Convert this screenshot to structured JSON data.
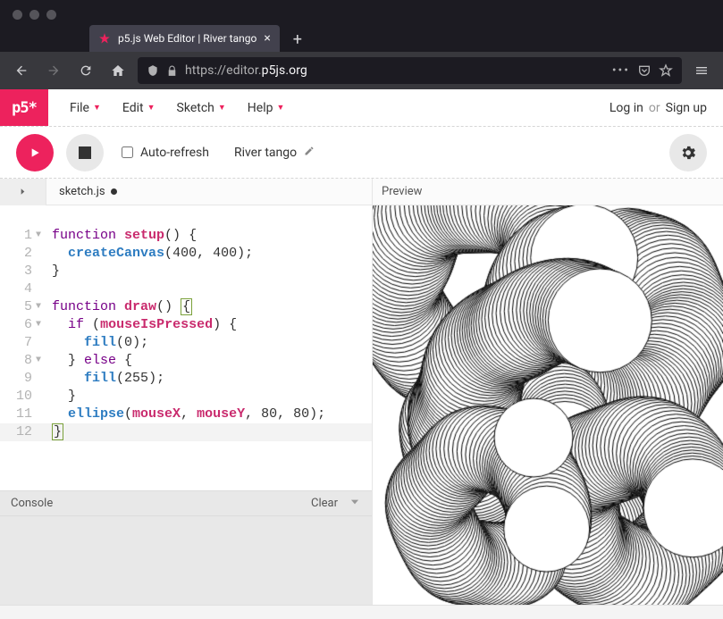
{
  "browser": {
    "tab_title": "p5.js Web Editor | River tango",
    "url_proto_sub": "https://editor.",
    "url_host_rest": "p5js.org",
    "new_tab": "+"
  },
  "app": {
    "logo": "p5*",
    "menu": [
      "File",
      "Edit",
      "Sketch",
      "Help"
    ],
    "auth": {
      "login": "Log in",
      "or": "or",
      "signup": "Sign up"
    }
  },
  "toolbar": {
    "auto_refresh_label": "Auto-refresh",
    "sketch_name": "River tango"
  },
  "editor": {
    "filename": "sketch.js",
    "lines": [
      {
        "n": 1,
        "fold": true,
        "tokens": [
          [
            "kw",
            "function"
          ],
          [
            "",
            ""
          ],
          [
            "var",
            "setup"
          ],
          [
            "punct",
            "() "
          ],
          [
            "brace",
            "{"
          ]
        ]
      },
      {
        "n": 2,
        "fold": false,
        "tokens": [
          [
            "",
            "  "
          ],
          [
            "p5fn",
            "createCanvas"
          ],
          [
            "punct",
            "("
          ],
          [
            "num",
            "400"
          ],
          [
            "punct",
            ", "
          ],
          [
            "num",
            "400"
          ],
          [
            "punct",
            ");"
          ]
        ]
      },
      {
        "n": 3,
        "fold": false,
        "tokens": [
          [
            "punct",
            "}"
          ]
        ]
      },
      {
        "n": 4,
        "fold": false,
        "tokens": []
      },
      {
        "n": 5,
        "fold": true,
        "tokens": [
          [
            "kw",
            "function"
          ],
          [
            "",
            ""
          ],
          [
            "var",
            "draw"
          ],
          [
            "punct",
            "() "
          ],
          [
            "bracebox",
            "{"
          ]
        ]
      },
      {
        "n": 6,
        "fold": true,
        "tokens": [
          [
            "",
            "  "
          ],
          [
            "kw",
            "if"
          ],
          [
            "",
            ""
          ],
          [
            "punct",
            "("
          ],
          [
            "var",
            "mouseIsPressed"
          ],
          [
            "punct",
            ") {"
          ]
        ]
      },
      {
        "n": 7,
        "fold": false,
        "tokens": [
          [
            "",
            "    "
          ],
          [
            "p5fn",
            "fill"
          ],
          [
            "punct",
            "("
          ],
          [
            "num",
            "0"
          ],
          [
            "punct",
            ");"
          ]
        ]
      },
      {
        "n": 8,
        "fold": true,
        "tokens": [
          [
            "",
            "  "
          ],
          [
            "punct",
            "} "
          ],
          [
            "kw",
            "else"
          ],
          [
            "punct",
            " {"
          ]
        ]
      },
      {
        "n": 9,
        "fold": false,
        "tokens": [
          [
            "",
            "    "
          ],
          [
            "p5fn",
            "fill"
          ],
          [
            "punct",
            "("
          ],
          [
            "num",
            "255"
          ],
          [
            "punct",
            ");"
          ]
        ]
      },
      {
        "n": 10,
        "fold": false,
        "tokens": [
          [
            "",
            "  "
          ],
          [
            "punct",
            "}"
          ]
        ]
      },
      {
        "n": 11,
        "fold": false,
        "tokens": [
          [
            "",
            "  "
          ],
          [
            "p5fn",
            "ellipse"
          ],
          [
            "punct",
            "("
          ],
          [
            "var",
            "mouseX"
          ],
          [
            "punct",
            ", "
          ],
          [
            "var",
            "mouseY"
          ],
          [
            "punct",
            ", "
          ],
          [
            "num",
            "80"
          ],
          [
            "punct",
            ", "
          ],
          [
            "num",
            "80"
          ],
          [
            "punct",
            ");"
          ]
        ]
      },
      {
        "n": 12,
        "fold": false,
        "hl": true,
        "tokens": [
          [
            "bracebox",
            "}"
          ]
        ]
      }
    ]
  },
  "console": {
    "label": "Console",
    "clear": "Clear"
  },
  "preview": {
    "label": "Preview"
  },
  "colors": {
    "accent": "#ed225d"
  }
}
